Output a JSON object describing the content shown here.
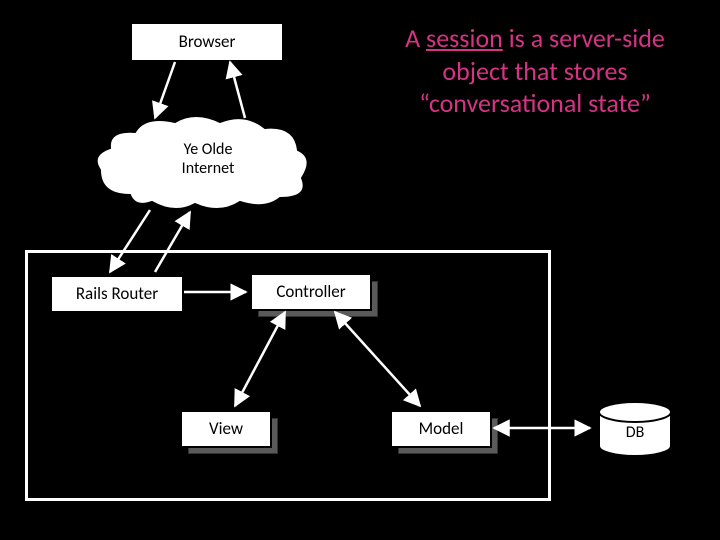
{
  "nodes": {
    "browser": "Browser",
    "internet": "Ye Olde\nInternet",
    "router": "Rails Router",
    "controller": "Controller",
    "view": "View",
    "model": "Model",
    "db": "DB"
  },
  "caption": {
    "pre": "A ",
    "u": "session",
    "post": " is a server-side object that stores “conversational state”"
  }
}
